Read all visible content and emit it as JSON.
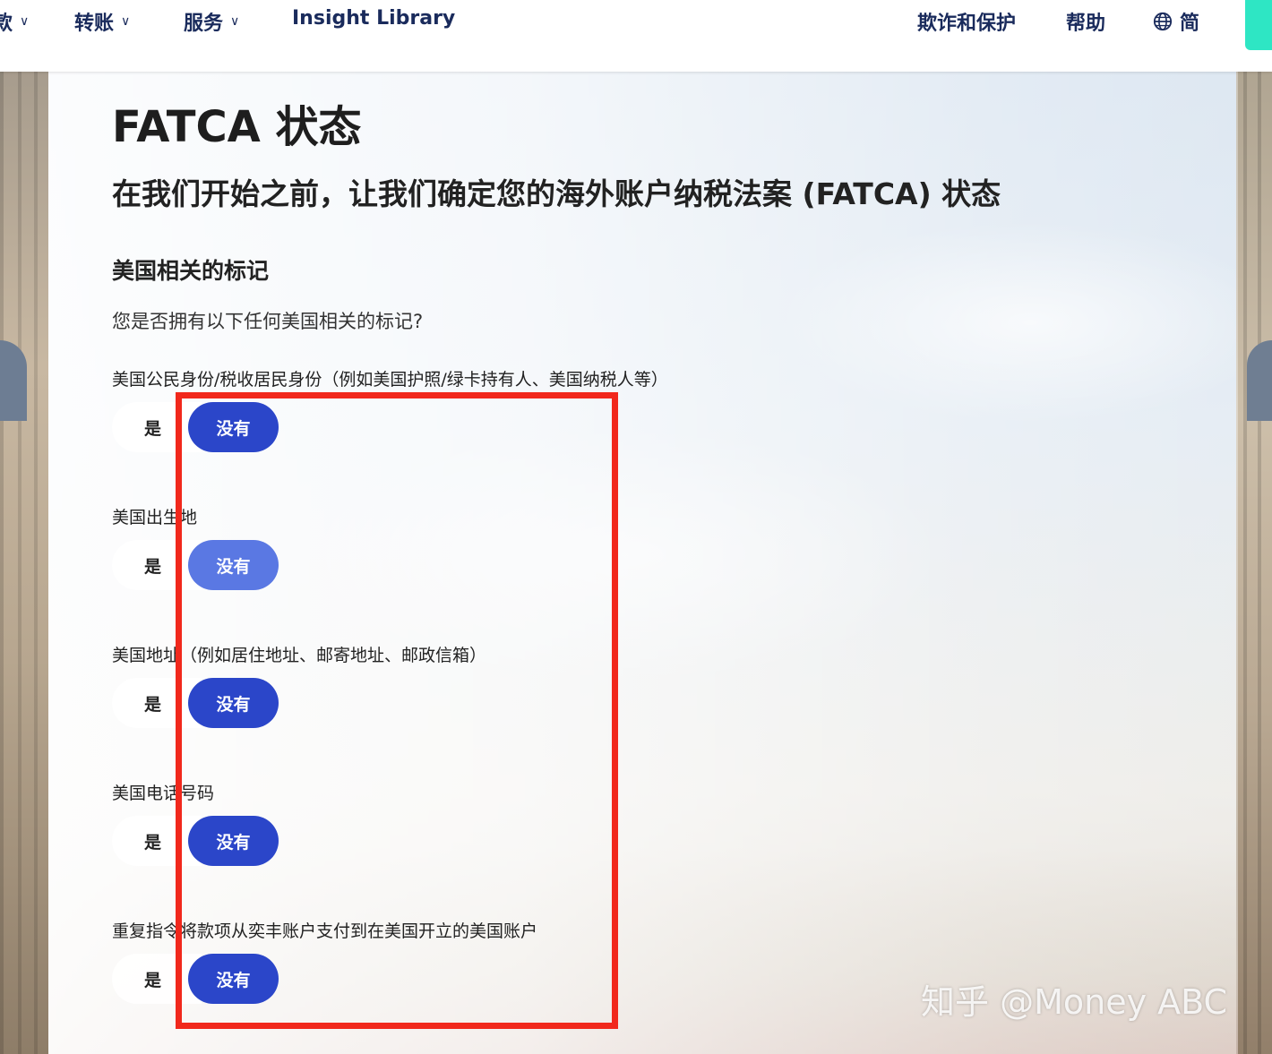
{
  "nav": {
    "items": [
      {
        "label": "款",
        "has_dropdown": true
      },
      {
        "label": "转账",
        "has_dropdown": true
      },
      {
        "label": "服务",
        "has_dropdown": true
      },
      {
        "label": "Insight Library",
        "has_dropdown": false
      }
    ],
    "right_items": [
      {
        "label": "欺诈和保护"
      },
      {
        "label": "帮助"
      },
      {
        "label": "简",
        "icon": "globe-icon"
      }
    ],
    "chevron": "∨",
    "accent_color": "#2ee6c4"
  },
  "page": {
    "title": "FATCA 状态",
    "subtitle": "在我们开始之前，让我们确定您的海外账户纳税法案 (FATCA) 状态",
    "section_title": "美国相关的标记",
    "question": "您是否拥有以下任何美国相关的标记?"
  },
  "indicators": [
    {
      "label": "美国公民身份/税收居民身份（例如美国护照/绿卡持有人、美国纳税人等）",
      "yes": "是",
      "no": "没有"
    },
    {
      "label": "美国出生地",
      "yes": "是",
      "no": "没有"
    },
    {
      "label": "美国地址（例如居住地址、邮寄地址、邮政信箱）",
      "yes": "是",
      "no": "没有"
    },
    {
      "label": "美国电话号码",
      "yes": "是",
      "no": "没有"
    },
    {
      "label": "重复指令将款项从奕丰账户支付到在美国开立的美国账户",
      "yes": "是",
      "no": "没有"
    }
  ],
  "colors": {
    "primary_button": "#2b46c9",
    "primary_button_hover": "#5a78e3",
    "annotation": "#f1281c"
  },
  "watermark": "知乎 @Money ABC"
}
